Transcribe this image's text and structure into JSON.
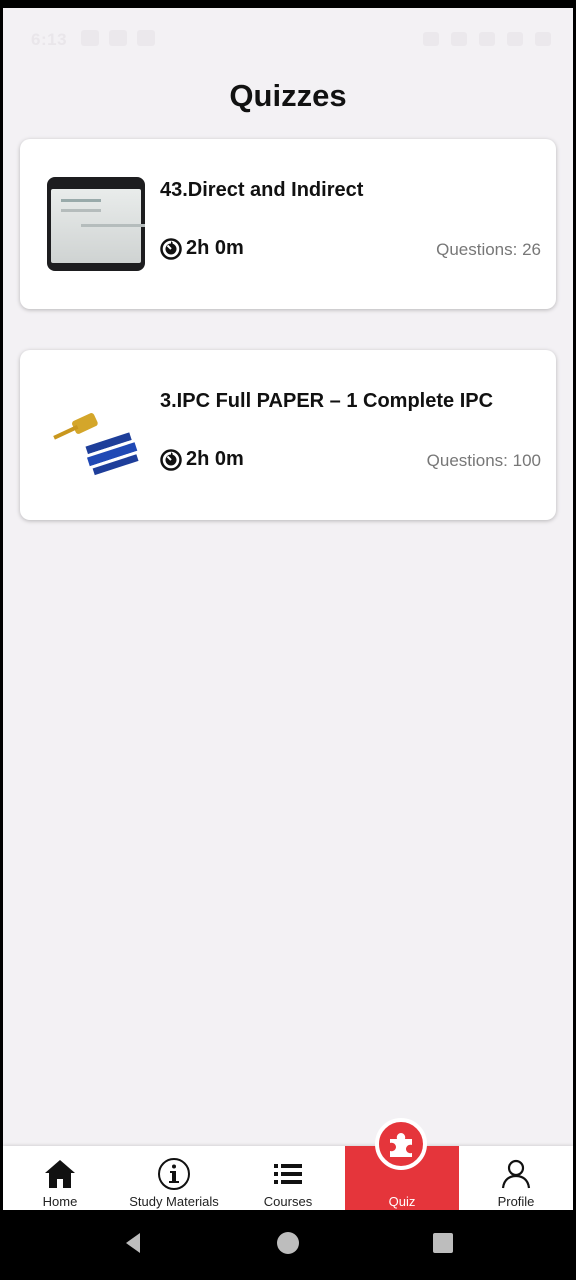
{
  "status_bar": {
    "time": "6:13"
  },
  "page": {
    "title": "Quizzes"
  },
  "quizzes": [
    {
      "title": "43.Direct and Indirect",
      "duration": "2h 0m",
      "questions": "Questions: 26",
      "thumbnail": "classroom-screen-image"
    },
    {
      "title": "3.IPC Full PAPER – 1 Complete IPC",
      "duration": "2h 0m",
      "questions": "Questions: 100",
      "thumbnail": "gavel-books-logo"
    }
  ],
  "nav": {
    "items": [
      {
        "label": "Home",
        "icon": "home-icon"
      },
      {
        "label": "Study Materials",
        "icon": "info-icon"
      },
      {
        "label": "Courses",
        "icon": "list-icon"
      },
      {
        "label": "Quiz",
        "icon": "puzzle-icon",
        "active": true
      },
      {
        "label": "Profile",
        "icon": "user-icon"
      }
    ]
  },
  "colors": {
    "accent": "#e5353b",
    "background": "#f3f1f4",
    "card": "#ffffff",
    "muted_text": "#777777"
  }
}
